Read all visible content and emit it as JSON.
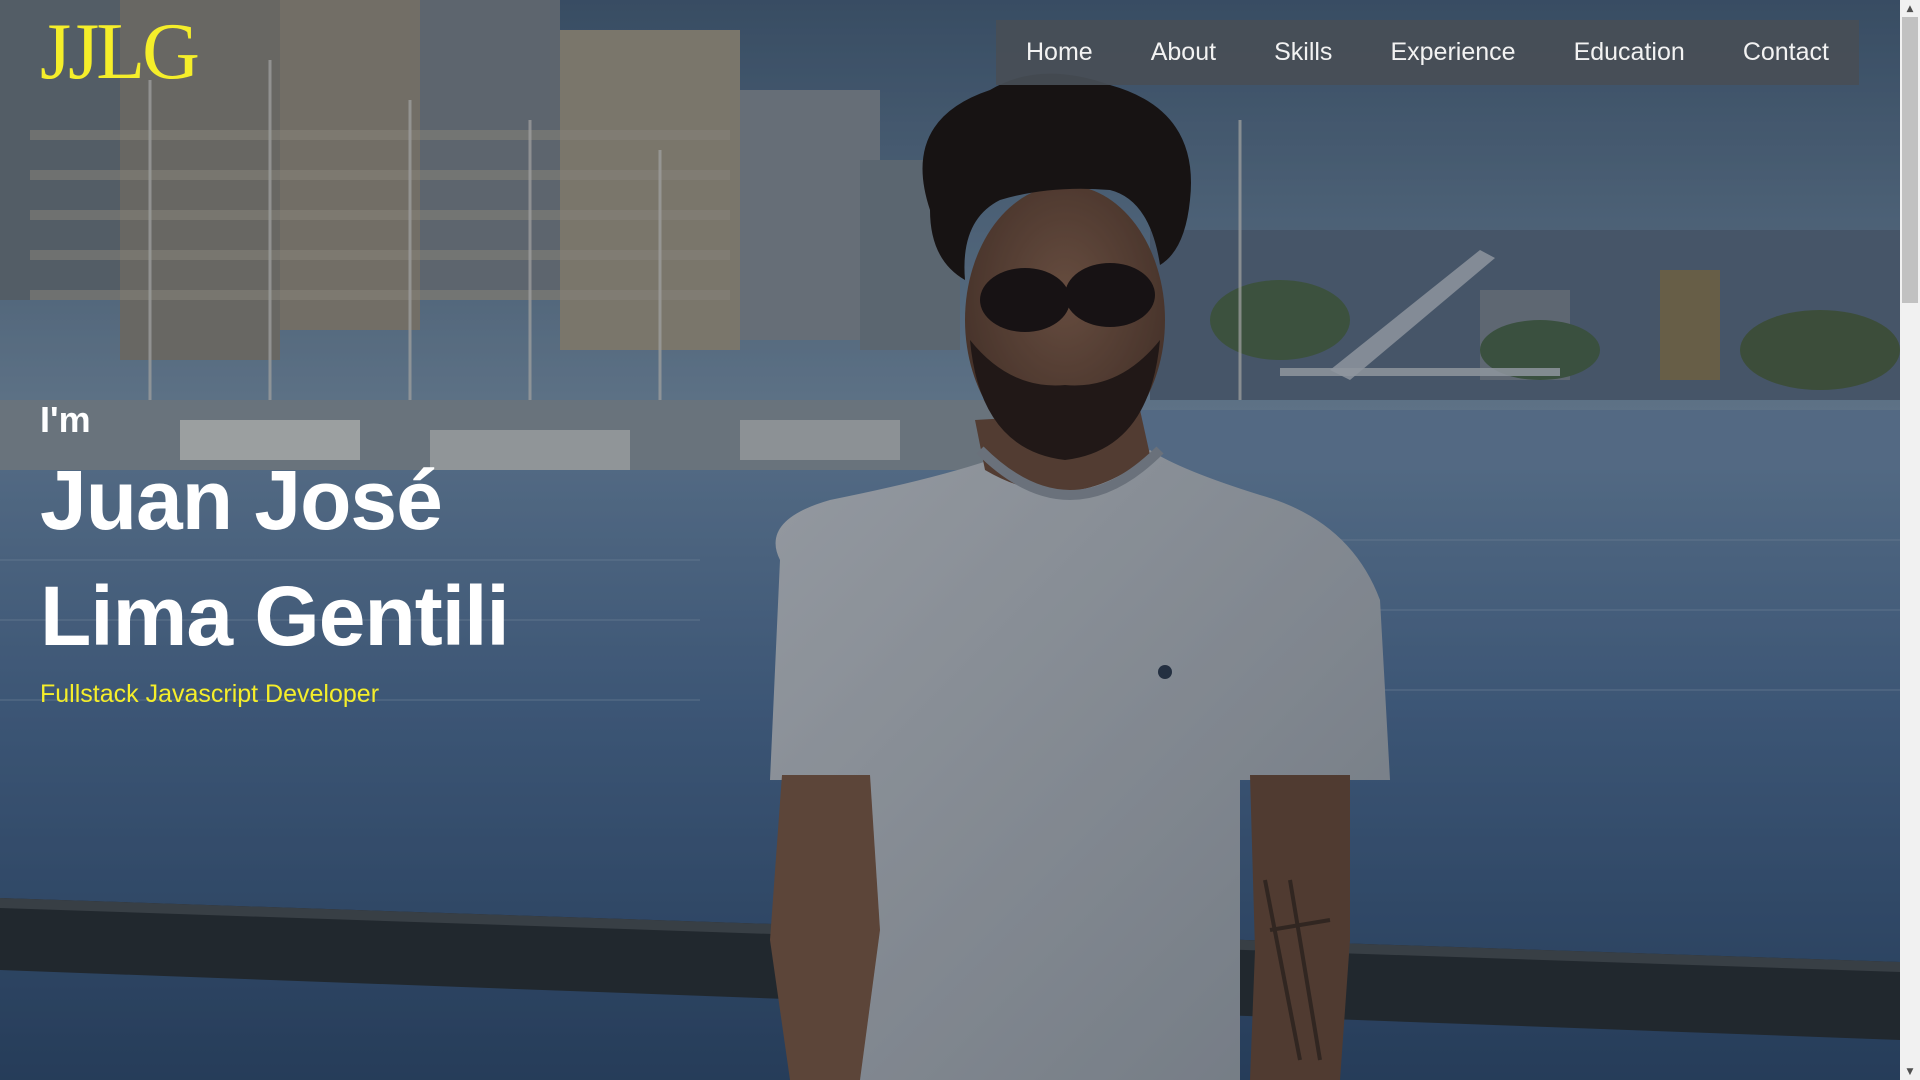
{
  "brand": {
    "logo_text": "JJLG",
    "accent_color": "#f5ee2a"
  },
  "nav": {
    "items": [
      {
        "label": "Home"
      },
      {
        "label": "About"
      },
      {
        "label": "Skills"
      },
      {
        "label": "Experience"
      },
      {
        "label": "Education"
      },
      {
        "label": "Contact"
      }
    ]
  },
  "hero": {
    "intro": "I'm",
    "name_first": "Juan José",
    "name_last": "Lima Gentili",
    "role": "Fullstack Javascript Developer",
    "background_image": "portrait-photo-waterfront"
  },
  "scrollbar": {
    "up_icon": "chevron-up-icon",
    "down_icon": "chevron-down-icon"
  }
}
